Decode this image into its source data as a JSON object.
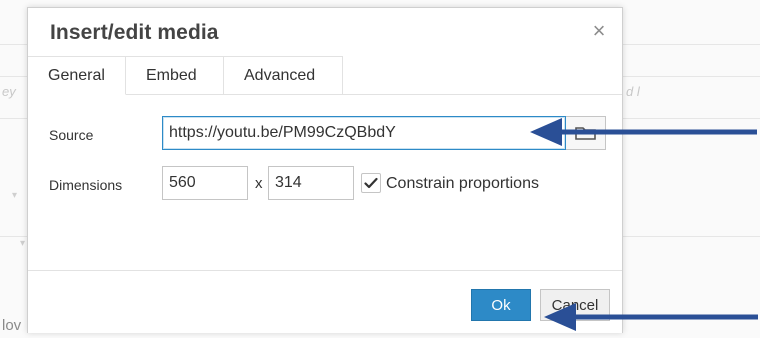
{
  "dialog": {
    "title": "Insert/edit media",
    "close_symbol": "×"
  },
  "tabs": [
    {
      "label": "General",
      "active": true
    },
    {
      "label": "Embed",
      "active": false
    },
    {
      "label": "Advanced",
      "active": false
    }
  ],
  "form": {
    "source_label": "Source",
    "source_value": "https://youtu.be/PM99CzQBbdY",
    "browse_icon": "folder-search-icon",
    "dimensions_label": "Dimensions",
    "width_value": "560",
    "separator": "x",
    "height_value": "314",
    "constrain_label": "Constrain proportions",
    "constrain_checked": true
  },
  "footer": {
    "ok_label": "Ok",
    "cancel_label": "Cancel"
  },
  "background": {
    "left_frag": "ey",
    "right_frag": "d l",
    "bottom_left_text": "lov"
  },
  "colors": {
    "primary_button": "#2d8ac7",
    "annotation_arrow": "#2a4f96"
  }
}
